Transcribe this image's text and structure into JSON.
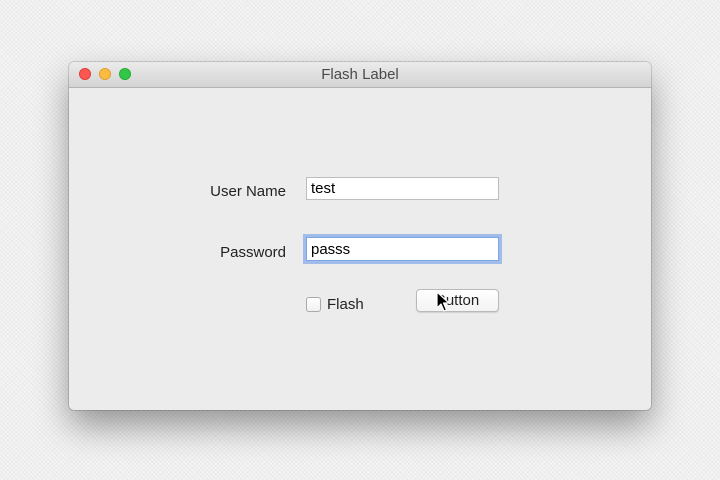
{
  "window": {
    "title": "Flash Label",
    "controls": [
      "close",
      "minimize",
      "zoom"
    ]
  },
  "form": {
    "username_label": "User Name",
    "username_value": "test",
    "password_label": "Password",
    "password_value": "passs",
    "flash_checkbox_label": "Flash",
    "flash_checked": false,
    "button_label": "Button"
  },
  "colors": {
    "close": "#fc5753",
    "minimize": "#fdbc40",
    "zoom": "#33c748",
    "focus_ring": "#7aa6e6"
  },
  "icons": {
    "cursor": "arrow-cursor-icon"
  }
}
